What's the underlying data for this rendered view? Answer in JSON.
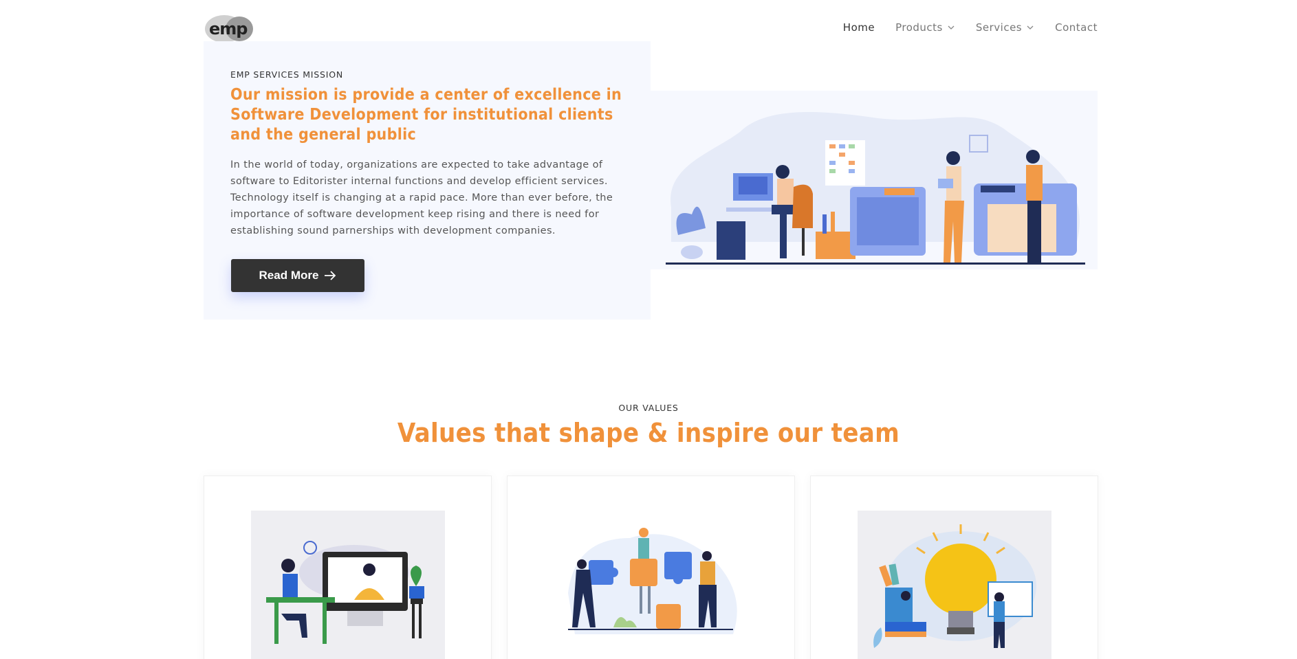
{
  "header": {
    "logo_text": "emp",
    "nav": [
      {
        "label": "Home",
        "active": true,
        "dropdown": false
      },
      {
        "label": "Products",
        "active": false,
        "dropdown": true
      },
      {
        "label": "Services",
        "active": false,
        "dropdown": true
      },
      {
        "label": "Contact",
        "active": false,
        "dropdown": false
      }
    ]
  },
  "hero": {
    "eyebrow": "EMP SERVICES MISSION",
    "title": "Our mission is provide a center of excellence in Software Development for institutional clients and the general public",
    "body": "In the world of today, organizations are expected to take advantage of software to Editorister internal functions and develop efficient services. Technology itself is changing at a rapid pace. More than ever before, the importance of software development keep rising and there is need for establishing sound parnerships with development companies.",
    "button_label": "Read More",
    "illustration_icon": "office-workers-illustration"
  },
  "values": {
    "eyebrow": "OUR VALUES",
    "title": "Values that shape & inspire our team",
    "cards": [
      {
        "icon": "online-teaching-illustration"
      },
      {
        "icon": "puzzle-teamwork-illustration"
      },
      {
        "icon": "lightbulb-idea-illustration"
      }
    ]
  },
  "colors": {
    "accent": "#f0913a",
    "dark_button": "#333333",
    "panel_bg": "#f6f8fe"
  }
}
